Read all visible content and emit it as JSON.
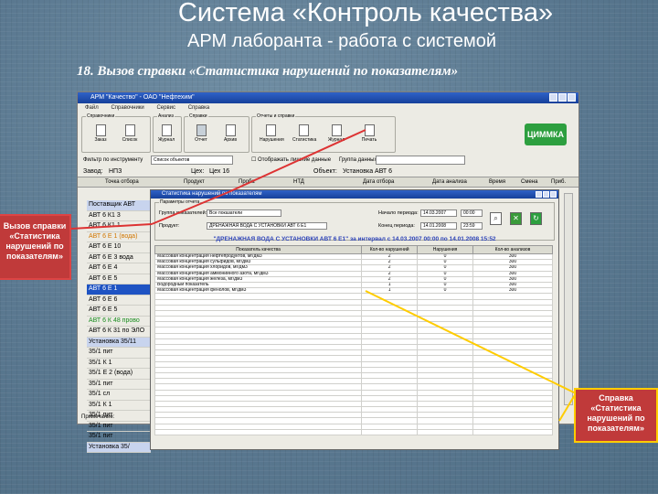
{
  "slide": {
    "title": "Система «Контроль качества»",
    "subtitle": "АРМ лаборанта - работа с системой",
    "caption": "18. Вызов справки «Статистика нарушений по показателям»"
  },
  "app": {
    "window_title": "АРМ \"Качество\" - ОАО \"Нефтехим\"",
    "menu": [
      "Файл",
      "Справочники",
      "Сервис",
      "Справка"
    ],
    "toolbar_groups": [
      {
        "label": "Справочники",
        "buttons": [
          "Заказ",
          "Список"
        ]
      },
      {
        "label": "Анализ",
        "buttons": [
          "Журнал",
          "Отчет"
        ]
      },
      {
        "label": "Справки",
        "buttons": [
          "Отчет",
          "Архив"
        ]
      },
      {
        "label": "Отчеты и справки",
        "buttons": [
          "Нарушения",
          "Статистика",
          "Журнал",
          "Печать"
        ]
      }
    ],
    "logo": "ЦИММКА",
    "filter": {
      "label": "Фильтр по инструменту",
      "value": "Список объектов",
      "check_label": "Отображать лишние данные",
      "group_label": "Группа данных"
    },
    "info": {
      "zavod_label": "Завод:",
      "zavod_value": "НПЗ",
      "ceh_label": "Цех:",
      "ceh_value": "Цех 16",
      "object_label": "Объект:",
      "object_value": "Установка АВТ 6"
    },
    "grid_headers": [
      "Точка отбора",
      "Продукт",
      "Проба",
      "НТД",
      "Дата отбора",
      "Дата анализа",
      "Время",
      "Смена",
      "Приб."
    ],
    "list_items": [
      {
        "text": "Поставщик АВТ",
        "style": "bluebg"
      },
      {
        "text": "АВТ 6 К1 3",
        "style": ""
      },
      {
        "text": "АВТ 6 К1 1",
        "style": ""
      },
      {
        "text": "АВТ 6 Е 1 (вода)",
        "style": "orange"
      },
      {
        "text": "АВТ 6 Е 10",
        "style": ""
      },
      {
        "text": "АВТ 6 Е 3 вода",
        "style": ""
      },
      {
        "text": "АВТ 6 Е 4",
        "style": ""
      },
      {
        "text": "АВТ 6 Е 5",
        "style": ""
      },
      {
        "text": "АВТ 6 Е 1",
        "style": "sel"
      },
      {
        "text": "АВТ 6 Е 6",
        "style": ""
      },
      {
        "text": "АВТ 6 Е 5",
        "style": ""
      },
      {
        "text": "АВТ 6 К 48 прово",
        "style": "green"
      },
      {
        "text": "АВТ 6 К 31 по ЭЛО",
        "style": ""
      },
      {
        "text": "Установка 35/11",
        "style": "bluebg"
      },
      {
        "text": "35/1 пит",
        "style": ""
      },
      {
        "text": "35/1 К 1",
        "style": ""
      },
      {
        "text": "35/1 Е 2 (вода)",
        "style": ""
      },
      {
        "text": "35/1 пит",
        "style": ""
      },
      {
        "text": "35/1 сл",
        "style": ""
      },
      {
        "text": "35/1 К 1",
        "style": ""
      },
      {
        "text": "35/1 пит",
        "style": ""
      },
      {
        "text": "35/1 пит",
        "style": ""
      },
      {
        "text": "35/1 пит",
        "style": ""
      },
      {
        "text": "Установка 35/",
        "style": "bluebg"
      }
    ],
    "status_label": "Примечание:"
  },
  "dialog": {
    "title": "Статистика нарушений по показателям",
    "params_label": "Параметры отчета",
    "group_label": "Группа показателей:",
    "group_value": "Все показатели",
    "product_label": "Продукт:",
    "product_value": "ДРЕНАЖНАЯ ВОДА С УСТАНОВКИ АВТ 6 Е1",
    "start_label": "Начало периода:",
    "start_value": "14.03.2007",
    "end_label": "Конец периода:",
    "end_value": "14.01.2008",
    "time_start": "00:00",
    "time_end": "23:59",
    "heading": "\"ДРЕНАЖНАЯ ВОДА С УСТАНОВКИ АВТ 6 Е1\" за интервал с 14.03.2007 00:00 по 14.01.2008 15:52",
    "columns": [
      "Показатель качества",
      "Кол-во нарушений",
      "Нарушения",
      "Кол-во анализов"
    ],
    "rows": [
      {
        "name": "Массовая концентрация нефтепродуктов, мг/дм3",
        "count": "2",
        "viol": "0",
        "total": "300"
      },
      {
        "name": "Массовая концентрация сульфидов, мг/дм3",
        "count": "2",
        "viol": "0",
        "total": "300"
      },
      {
        "name": "Массовая концентрация хлоридов, мг/дм3",
        "count": "2",
        "viol": "0",
        "total": "300"
      },
      {
        "name": "Массовая концентрация аммонийного азота, мг/дм3",
        "count": "2",
        "viol": "0",
        "total": "300"
      },
      {
        "name": "Массовая концентрация железа, мг/дм3",
        "count": "2",
        "viol": "0",
        "total": "300"
      },
      {
        "name": "Водородный показатель",
        "count": "1",
        "viol": "0",
        "total": "300"
      },
      {
        "name": "Массовая концентрация фенолов, мг/дм3",
        "count": "1",
        "viol": "0",
        "total": "300"
      }
    ]
  },
  "callouts": {
    "left": "Вызов справки «Статистика нарушений по показателям»",
    "right": "Справка «Статистика нарушений по показателям»"
  },
  "colors": {
    "accent_red": "#c03a3a",
    "accent_yellow": "#ffcc00",
    "selection": "#1e53c3",
    "logo": "#2d9f3f"
  }
}
